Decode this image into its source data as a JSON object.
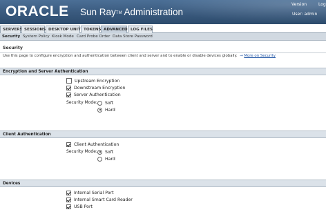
{
  "header": {
    "logo": "ORACLE",
    "app_name": "Sun Ray",
    "app_name_suffix": "Administration",
    "trademark": "TM",
    "version_link": "Version",
    "logout_link": "Log",
    "user_label": "User: admin"
  },
  "tabs": [
    {
      "label": "SERVERS",
      "active": false
    },
    {
      "label": "SESSIONS",
      "active": false
    },
    {
      "label": "DESKTOP UNITS",
      "active": false
    },
    {
      "label": "TOKENS",
      "active": false
    },
    {
      "label": "ADVANCED",
      "active": true
    },
    {
      "label": "LOG FILES",
      "active": false
    }
  ],
  "subtabs": [
    {
      "label": "Security",
      "active": true
    },
    {
      "label": "System Policy",
      "active": false
    },
    {
      "label": "Kiosk Mode",
      "active": false
    },
    {
      "label": "Card Probe Order",
      "active": false
    },
    {
      "label": "Data Store Password",
      "active": false
    }
  ],
  "page": {
    "title": "Security",
    "description": "Use this page to configure encryption and authentication between client and server and to enable or disable devices globally.",
    "more_link": "More on Security"
  },
  "encryption_section": {
    "title": "Encryption and Server Authentication",
    "upstream": {
      "label": "Upstream Encryption",
      "checked": false
    },
    "downstream": {
      "label": "Downstream Encryption",
      "checked": true
    },
    "server_auth": {
      "label": "Server Authentication",
      "checked": true
    },
    "mode_label": "Security Mode:",
    "soft": {
      "label": "Soft",
      "selected": false
    },
    "hard": {
      "label": "Hard",
      "selected": true
    }
  },
  "client_section": {
    "title": "Client Authentication",
    "client_auth": {
      "label": "Client Authentication",
      "checked": true
    },
    "mode_label": "Security Mode:",
    "soft": {
      "label": "Soft",
      "selected": true
    },
    "hard": {
      "label": "Hard",
      "selected": false
    }
  },
  "devices_section": {
    "title": "Devices",
    "serial": {
      "label": "Internal Serial Port",
      "checked": true
    },
    "smartcard": {
      "label": "Internal Smart Card Reader",
      "checked": true
    },
    "usb": {
      "label": "USB Port",
      "checked": true
    }
  }
}
